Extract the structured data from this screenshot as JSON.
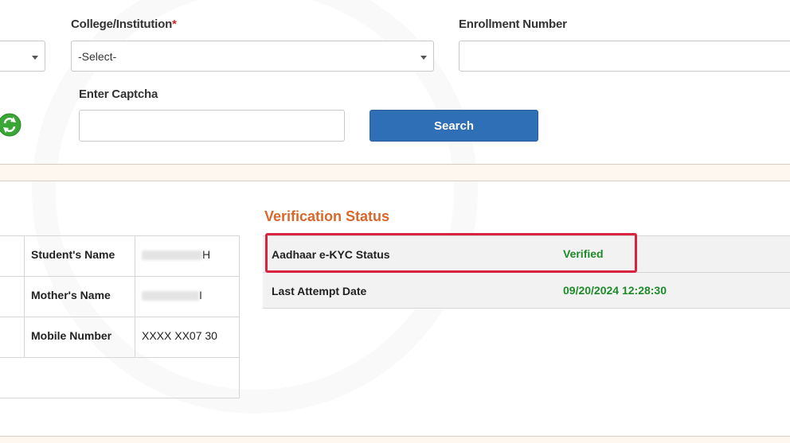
{
  "form": {
    "college_label": "College/Institution",
    "required_mark": "*",
    "college_select_value": "-Select-",
    "enrollment_label": "Enrollment Number",
    "enrollment_value": "",
    "captcha_label": "Enter Captcha",
    "captcha_value": "",
    "search_label": "Search"
  },
  "student": {
    "rows": [
      {
        "label": "Student's Name",
        "value": "H"
      },
      {
        "label": "Mother's Name",
        "value": "I"
      },
      {
        "label": "Mobile Number",
        "value": "XXXX XX07 30"
      }
    ]
  },
  "verification": {
    "title": "Verification Status",
    "rows": [
      {
        "label": "Aadhaar e-KYC Status",
        "value": "Verified"
      },
      {
        "label": "Last Attempt Date",
        "value": "09/20/2024 12:28:30"
      }
    ]
  },
  "colors": {
    "accent_blue": "#2f6fb5",
    "title_orange": "#d9662a",
    "verified_green": "#1f8a2a",
    "highlight_red": "#d8243f"
  }
}
